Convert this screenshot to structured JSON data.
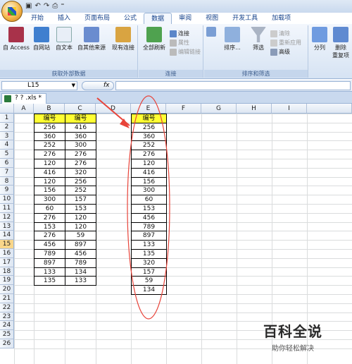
{
  "quick_access": {
    "save": "▣",
    "undo": "↶",
    "redo": "↷",
    "print": "⎙",
    "more": "⁼"
  },
  "tabs": [
    "开始",
    "插入",
    "页面布局",
    "公式",
    "数据",
    "审阅",
    "视图",
    "开发工具",
    "加载项"
  ],
  "active_tab": "数据",
  "ribbon": {
    "groups": {
      "external": "获取外部数据",
      "connections": "连接",
      "sort_filter": "排序和筛选"
    },
    "buttons": {
      "from_access": "自 Access",
      "from_web": "自网站",
      "from_text": "自文本",
      "from_other": "自其他来源",
      "existing_conn": "现有连接",
      "refresh_all": "全部刷新",
      "connections": "连接",
      "properties": "属性",
      "edit_links": "编辑链接",
      "sort": "排序...",
      "filter": "筛选",
      "clear": "清除",
      "reapply": "重新应用",
      "advanced": "高级",
      "text_to_columns": "分列",
      "remove_dup_1": "删除",
      "remove_dup_2": "重复项"
    }
  },
  "formula_bar": {
    "name_box": "L15",
    "fx": "fx",
    "content": ""
  },
  "document_tab": "? ? .xls *",
  "columns": [
    "A",
    "B",
    "C",
    "D",
    "E",
    "F",
    "G",
    "H",
    "I"
  ],
  "rows": [
    "1",
    "2",
    "3",
    "4",
    "5",
    "6",
    "7",
    "8",
    "9",
    "10",
    "11",
    "12",
    "13",
    "14",
    "15",
    "16",
    "17",
    "18",
    "19",
    "20",
    "21",
    "22",
    "23",
    "24",
    "25",
    "26"
  ],
  "selected_row": "15",
  "col_a": [
    "编号",
    "256",
    "360",
    "252",
    "276",
    "120",
    "416",
    "120",
    "156",
    "300",
    "60",
    "276",
    "153",
    "276",
    "456",
    "789",
    "897",
    "133",
    "135"
  ],
  "col_b": [
    "编号",
    "416",
    "360",
    "300",
    "276",
    "276",
    "320",
    "256",
    "252",
    "157",
    "153",
    "120",
    "120",
    "59",
    "897",
    "456",
    "789",
    "134",
    "133"
  ],
  "col_d": [
    "编号",
    "256",
    "360",
    "252",
    "276",
    "120",
    "416",
    "156",
    "300",
    "60",
    "153",
    "456",
    "789",
    "897",
    "133",
    "135",
    "320",
    "157",
    "59",
    "134"
  ],
  "watermark": {
    "title": "百科全说",
    "subtitle": "助你轻松解决"
  },
  "colors": {
    "header_fill": "#ffff33",
    "annotation": "#e8443a",
    "selected_row": "#f9d68a"
  }
}
